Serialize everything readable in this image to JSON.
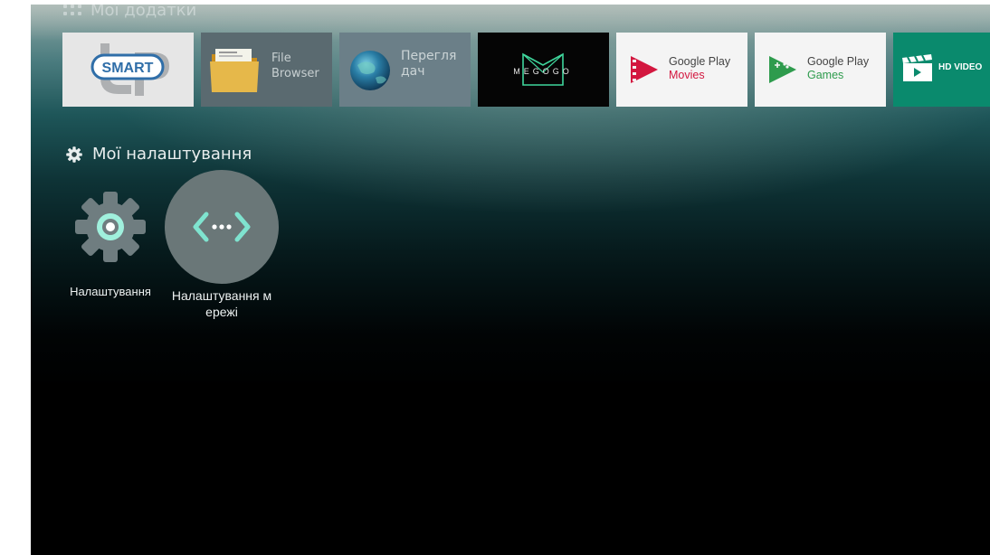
{
  "apps_section": {
    "title": "Мої додатки",
    "tiles": [
      {
        "name": "UP SMART",
        "logo_text": "SMART"
      },
      {
        "name": "File Browser",
        "line1": "File",
        "line2": "Browser"
      },
      {
        "name": "Переглядач",
        "line1": "Перегля",
        "line2": "дач"
      },
      {
        "name": "MEGOGO",
        "logo_text": "MEGOGO"
      },
      {
        "name": "Google Play Movies",
        "line1": "Google Play",
        "line2": "Movies"
      },
      {
        "name": "Google Play Games",
        "line1": "Google Play",
        "line2": "Games"
      },
      {
        "name": "HD VIDEO",
        "label": "HD VIDEO"
      }
    ]
  },
  "settings_section": {
    "title": "Мої налаштування",
    "items": [
      {
        "label": "Налаштування"
      },
      {
        "label": "Налаштування мережі"
      }
    ]
  },
  "colors": {
    "up_blue": "#2f6ea8",
    "gp_movies_red": "#d3173f",
    "gp_games_green": "#2e9b4d",
    "hd_video_green": "#0a8a6d",
    "settings_accent": "#7fe3cf"
  }
}
